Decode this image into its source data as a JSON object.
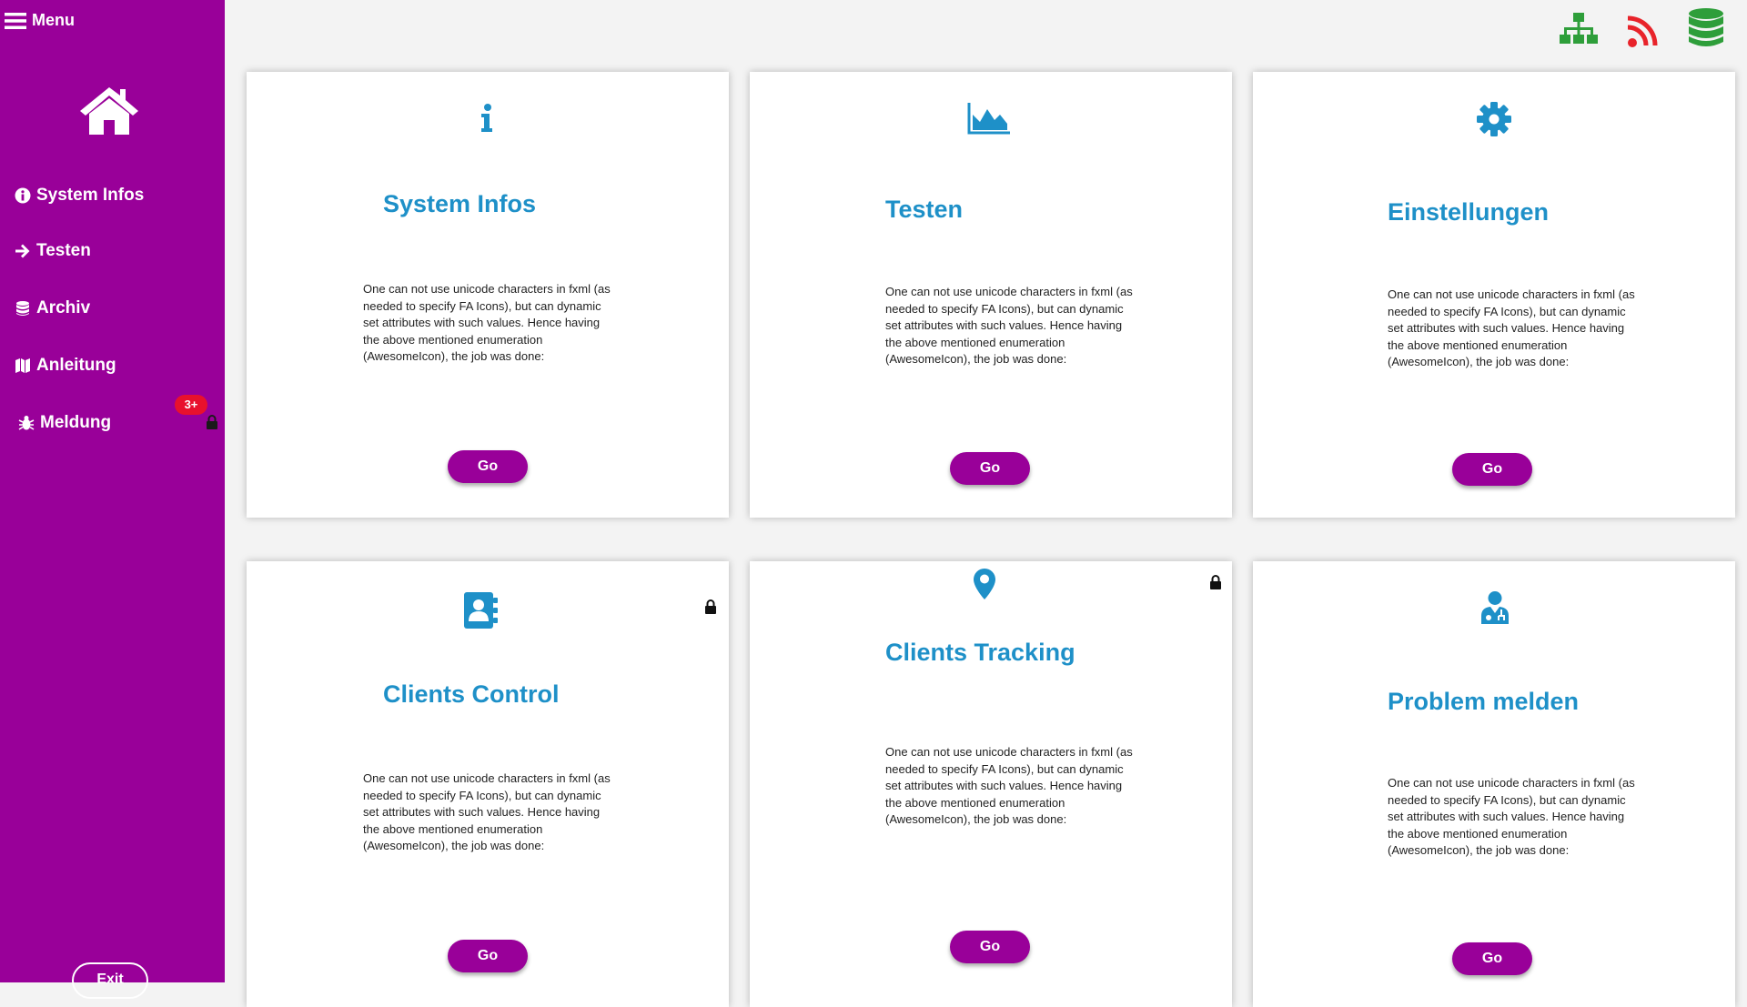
{
  "menu": {
    "label": "Menu"
  },
  "sidebar": {
    "items": [
      {
        "label": "System Infos",
        "icon": "info-circle-icon"
      },
      {
        "label": "Testen",
        "icon": "arrow-right-icon"
      },
      {
        "label": "Archiv",
        "icon": "database-icon"
      },
      {
        "label": "Anleitung",
        "icon": "map-icon"
      },
      {
        "label": "Meldung",
        "icon": "bug-icon"
      }
    ],
    "badge": "3+",
    "exit_label": "Exit"
  },
  "topbar": {
    "icons": [
      "sitemap-icon",
      "rss-icon",
      "database-icon"
    ],
    "colors": {
      "sitemap": "#2e9e3a",
      "rss": "#e8232a",
      "database": "#2e9e3a"
    }
  },
  "cards": [
    {
      "title": "System Infos",
      "icon": "info-icon",
      "locked": false,
      "text": "One can not use unicode characters in fxml (as needed to specify FA Icons), but can dynamic set attributes with such values. Hence having the above mentioned enumeration (AwesomeIcon), the job was done:",
      "button": "Go"
    },
    {
      "title": "Testen",
      "icon": "area-chart-icon",
      "locked": false,
      "text": "One can not use unicode characters in fxml (as needed to specify FA Icons), but can dynamic set attributes with such values. Hence having the above mentioned enumeration (AwesomeIcon), the job was done:",
      "button": "Go"
    },
    {
      "title": "Einstellungen",
      "icon": "gear-icon",
      "locked": false,
      "text": "One can not use unicode characters in fxml (as needed to specify FA Icons), but can dynamic set attributes with such values. Hence having the above mentioned enumeration (AwesomeIcon), the job was done:",
      "button": "Go"
    },
    {
      "title": "Clients Control",
      "icon": "address-book-icon",
      "locked": true,
      "text": "One can not use unicode characters in fxml (as needed to specify FA Icons), but can dynamic set attributes with such values. Hence having the above mentioned enumeration (AwesomeIcon), the job was done:",
      "button": "Go"
    },
    {
      "title": "Clients Tracking",
      "icon": "map-marker-icon",
      "locked": true,
      "text": "One can not use unicode characters in fxml (as needed to specify FA Icons), but can dynamic set attributes with such values. Hence having the above mentioned enumeration (AwesomeIcon), the job was done:",
      "button": "Go"
    },
    {
      "title": "Problem melden",
      "icon": "user-doctor-icon",
      "locked": false,
      "text": "One can not use unicode characters in fxml (as needed to specify FA Icons), but can dynamic set attributes with such values. Hence having the above mentioned enumeration (AwesomeIcon), the job was done:",
      "button": "Go"
    }
  ],
  "colors": {
    "sidebar": "#990099",
    "accent": "#1e90c8",
    "badge": "#e8112d"
  }
}
